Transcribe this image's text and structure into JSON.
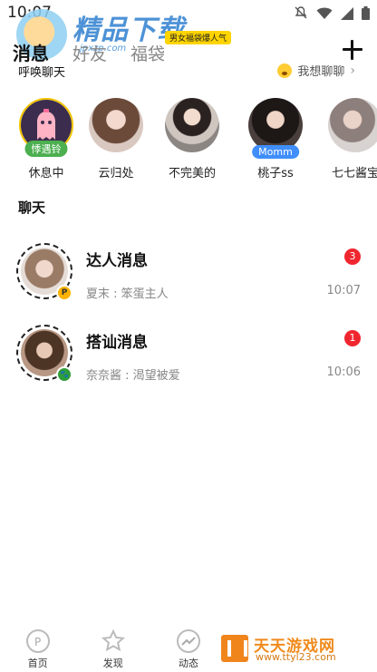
{
  "status_bar": {
    "time": "10:07"
  },
  "watermark": {
    "title": "精品下载",
    "url": "jpxzp.com",
    "bottom_brand": "天天游戏网",
    "bottom_url": "www.ttyl23.com"
  },
  "tabs": [
    {
      "label": "消息",
      "active": true
    },
    {
      "label": "好友",
      "active": false
    },
    {
      "label": "福袋",
      "active": false
    }
  ],
  "tab_badge": "男女福袋爆人气",
  "recall": {
    "title": "呼唤聊天",
    "want_chat": "我想聊聊"
  },
  "avatars": [
    {
      "name": "休息中",
      "tag": "悸遇铃",
      "tag_color": "#4caf50"
    },
    {
      "name": "云归处",
      "tag": ""
    },
    {
      "name": "不完美的",
      "tag": ""
    },
    {
      "name": "桃子ss",
      "tag": "Momm",
      "tag_color": "#3f8efc"
    },
    {
      "name": "七七酱宝",
      "tag": ""
    }
  ],
  "section_title": "聊天",
  "chats": [
    {
      "name": "达人消息",
      "preview": "夏末 : 笨蛋主人",
      "time": "10:07",
      "unread": "3",
      "badge": "P",
      "badge_color": "#ffb300"
    },
    {
      "name": "搭讪消息",
      "preview": "奈奈酱 : 渴望被爱",
      "time": "10:06",
      "unread": "1",
      "badge": "🐾",
      "badge_color": "#2e9d3a"
    }
  ],
  "nav": [
    {
      "label": "首页",
      "icon": "home-icon"
    },
    {
      "label": "发现",
      "icon": "star-icon"
    },
    {
      "label": "动态",
      "icon": "trend-icon"
    },
    {
      "label": "",
      "icon": "message-icon"
    },
    {
      "label": "",
      "icon": "profile-icon"
    }
  ]
}
